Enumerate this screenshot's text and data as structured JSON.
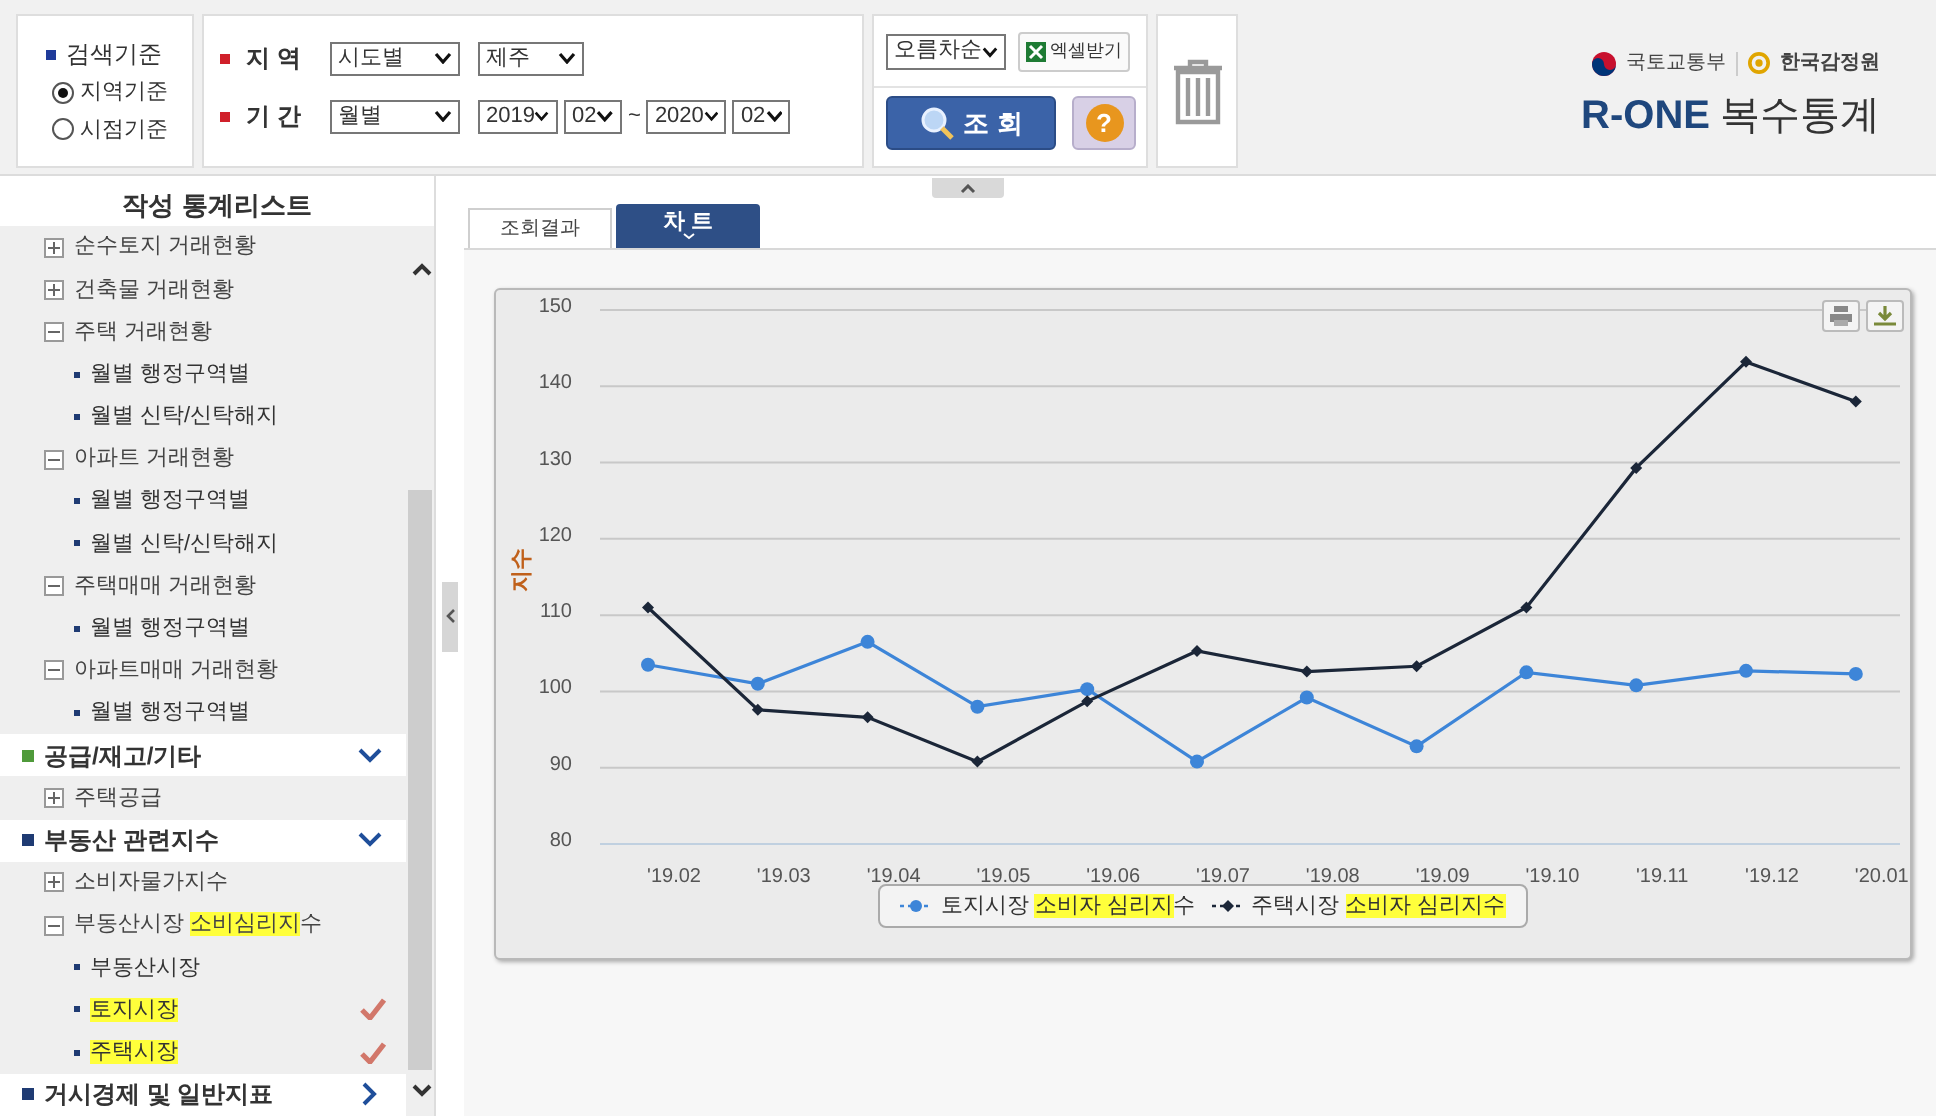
{
  "search_criteria": {
    "title": "검색기준",
    "options": [
      {
        "label": "지역기준",
        "selected": true
      },
      {
        "label": "시점기준",
        "selected": false
      }
    ]
  },
  "region": {
    "label": "지 역",
    "type": {
      "value": "시도별"
    },
    "area": {
      "value": "제주"
    }
  },
  "period": {
    "label": "기 간",
    "unit": {
      "value": "월별"
    },
    "from_year": {
      "value": "2019"
    },
    "from_month": {
      "value": "02"
    },
    "separator": "~",
    "to_year": {
      "value": "2020"
    },
    "to_month": {
      "value": "02"
    }
  },
  "sort": {
    "value": "오름차순"
  },
  "excel_button": "엑셀받기",
  "search_button": "조 회",
  "help_button": "?",
  "logo": {
    "ministry": "국토교통부",
    "agency": "한국감정원",
    "brand": "R-ONE",
    "product": "복수통계"
  },
  "sidebar": {
    "title": "작성 통계리스트",
    "items": [
      {
        "kind": "group",
        "label": "순수토지 거래현황",
        "expanded": false
      },
      {
        "kind": "group",
        "label": "건축물 거래현황",
        "expanded": false
      },
      {
        "kind": "group",
        "label": "주택 거래현황",
        "expanded": true,
        "children": [
          {
            "kind": "leaf",
            "label": "월별 행정구역별",
            "checked": false
          },
          {
            "kind": "leaf",
            "label": "월별 신탁/신탁해지",
            "checked": false
          }
        ]
      },
      {
        "kind": "group",
        "label": "아파트 거래현황",
        "expanded": true,
        "children": [
          {
            "kind": "leaf",
            "label": "월별 행정구역별",
            "checked": false
          },
          {
            "kind": "leaf",
            "label": "월별 신탁/신탁해지",
            "checked": false
          }
        ]
      },
      {
        "kind": "group",
        "label": "주택매매 거래현황",
        "expanded": true,
        "children": [
          {
            "kind": "leaf",
            "label": "월별 행정구역별",
            "checked": false
          }
        ]
      },
      {
        "kind": "group",
        "label": "아파트매매 거래현황",
        "expanded": true,
        "children": [
          {
            "kind": "leaf",
            "label": "월별 행정구역별",
            "checked": false
          }
        ]
      },
      {
        "kind": "section",
        "label": "공급/재고/기타",
        "color": "#4f9a3a",
        "expanded": true,
        "children": [
          {
            "kind": "group",
            "label": "주택공급",
            "expanded": false
          }
        ]
      },
      {
        "kind": "section",
        "label": "부동산 관련지수",
        "color": "#1f3b73",
        "expanded": true,
        "children": [
          {
            "kind": "group",
            "label": "소비자물가지수",
            "expanded": false
          },
          {
            "kind": "group",
            "label_parts": [
              {
                "text": "부동산시장 ",
                "highlighted": false
              },
              {
                "text": "소비심리지",
                "highlighted": true
              },
              {
                "text": "수",
                "highlighted": false
              }
            ],
            "expanded": true,
            "children": [
              {
                "kind": "leaf",
                "label": "부동산시장",
                "checked": false,
                "highlighted": false
              },
              {
                "kind": "leaf",
                "label": "토지시장",
                "checked": true,
                "highlighted": true
              },
              {
                "kind": "leaf",
                "label": "주택시장",
                "checked": true,
                "highlighted": true
              }
            ]
          }
        ]
      },
      {
        "kind": "section",
        "label": "거시경제 및 일반지표",
        "color": "#1f3b73",
        "expanded": false
      }
    ]
  },
  "tabs": [
    {
      "label": "조회결과",
      "selected": false
    },
    {
      "label": "차 트",
      "selected": true
    }
  ],
  "chart": {
    "chart_data": {
      "type": "line",
      "ylabel": "지수",
      "categories": [
        "'19.02",
        "'19.03",
        "'19.04",
        "'19.05",
        "'19.06",
        "'19.07",
        "'19.08",
        "'19.09",
        "'19.10",
        "'19.11",
        "'19.12",
        "'20.01"
      ],
      "ylim": [
        80,
        150
      ],
      "yticks": [
        80,
        90,
        100,
        110,
        120,
        130,
        140,
        150
      ],
      "grid": true,
      "series": [
        {
          "color": "#3d85d8",
          "marker": "circle",
          "values": [
            103.5,
            101,
            106.5,
            98,
            100.3,
            90.8,
            99.2,
            92.8,
            102.5,
            100.8,
            102.7,
            102.3
          ]
        },
        {
          "color": "#1b2638",
          "marker": "diamond",
          "values": [
            111,
            97.6,
            96.6,
            90.8,
            98.7,
            105.3,
            102.6,
            103.3,
            111,
            129.3,
            143.2,
            138
          ]
        }
      ]
    },
    "legend": [
      {
        "parts": [
          {
            "text": "토지시장 ",
            "highlighted": false
          },
          {
            "text": "소비자 심리지",
            "highlighted": true
          },
          {
            "text": "수",
            "highlighted": false
          }
        ]
      },
      {
        "parts": [
          {
            "text": "주택시장 ",
            "highlighted": false
          },
          {
            "text": "소비자 심리지수",
            "highlighted": true
          }
        ]
      }
    ]
  }
}
